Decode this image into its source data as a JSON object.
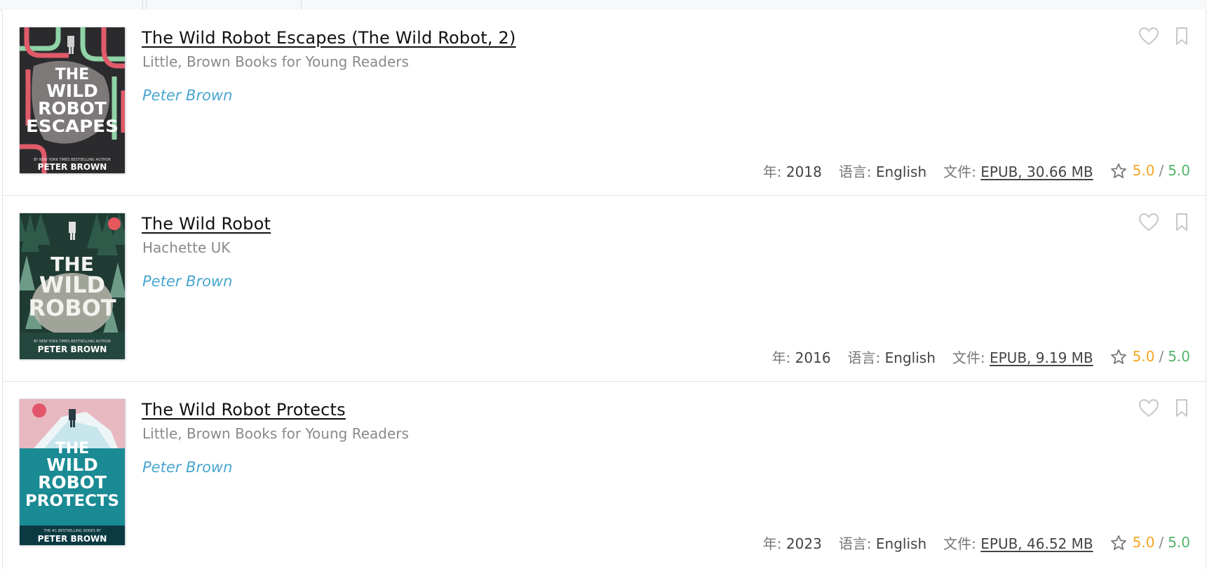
{
  "colors": {
    "author": "#49a6cf",
    "rating_value": "#f5a623",
    "rating_max": "#52b36a"
  },
  "labels": {
    "year": "年:",
    "language": "语言:",
    "file": "文件:"
  },
  "books": [
    {
      "title": "The Wild Robot Escapes (The Wild Robot, 2)",
      "publisher": "Little, Brown Books for Young Readers",
      "author": "Peter Brown",
      "year": "2018",
      "language": "English",
      "file": "EPUB, 30.66 MB",
      "rating": "5.0",
      "rating_max": "5.0",
      "cover": {
        "line1": "THE",
        "line2": "WILD",
        "line3": "ROBOT",
        "line4": "ESCAPES",
        "tagline": "BY NEW YORK TIMES BESTSELLING AUTHOR",
        "author": "PETER BROWN"
      }
    },
    {
      "title": "The Wild Robot",
      "publisher": "Hachette UK",
      "author": "Peter Brown",
      "year": "2016",
      "language": "English",
      "file": "EPUB, 9.19 MB",
      "rating": "5.0",
      "rating_max": "5.0",
      "cover": {
        "line1": "THE",
        "line2": "WILD",
        "line3": "ROBOT",
        "tagline": "BY NEW YORK TIMES BESTSELLING AUTHOR",
        "author": "PETER BROWN"
      }
    },
    {
      "title": "The Wild Robot Protects",
      "publisher": "Little, Brown Books for Young Readers",
      "author": "Peter Brown",
      "year": "2023",
      "language": "English",
      "file": "EPUB, 46.52 MB",
      "rating": "5.0",
      "rating_max": "5.0",
      "cover": {
        "line1": "THE",
        "line2": "WILD",
        "line3": "ROBOT",
        "line4": "PROTECTS",
        "tagline": "THE #1 BESTSELLING SERIES BY",
        "author": "PETER BROWN"
      }
    }
  ]
}
